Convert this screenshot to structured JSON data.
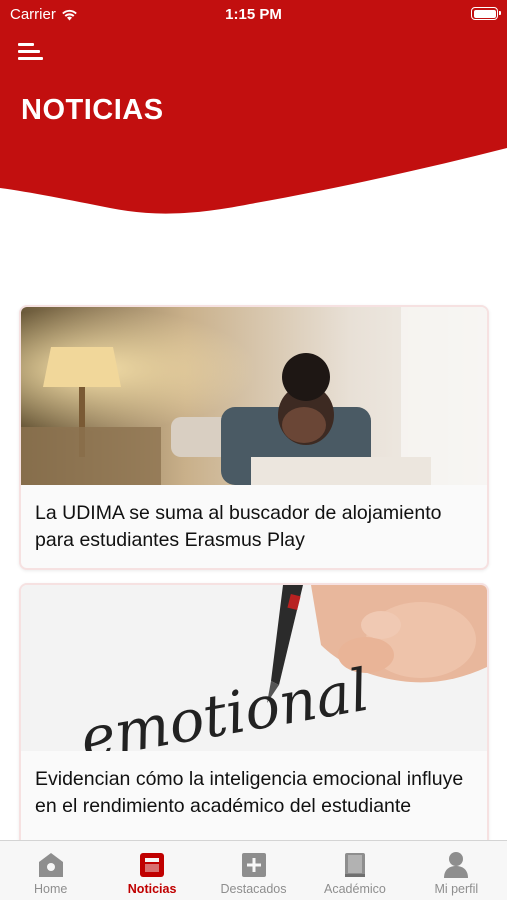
{
  "status_bar": {
    "carrier": "Carrier",
    "time": "1:15 PM"
  },
  "header": {
    "title": "NOTICIAS",
    "background_color": "#c20f0f"
  },
  "news": [
    {
      "title": "La UDIMA se suma al buscador de alojamiento para estudiantes Erasmus Play",
      "image": "student-studying-at-home-photo"
    },
    {
      "title": "Evidencian cómo la inteligencia emocional influye en el rendimiento académico del estudiante",
      "image": "hand-writing-emotional-photo",
      "image_text": "emotional"
    }
  ],
  "tab_bar": {
    "active_color": "#c00000",
    "inactive_color": "#8e8e8e",
    "items": [
      {
        "label": "Home",
        "icon": "home-icon",
        "active": false
      },
      {
        "label": "Noticias",
        "icon": "news-icon",
        "active": true
      },
      {
        "label": "Destacados",
        "icon": "plus-icon",
        "active": false
      },
      {
        "label": "Académico",
        "icon": "book-icon",
        "active": false
      },
      {
        "label": "Mi perfil",
        "icon": "user-icon",
        "active": false
      }
    ]
  }
}
